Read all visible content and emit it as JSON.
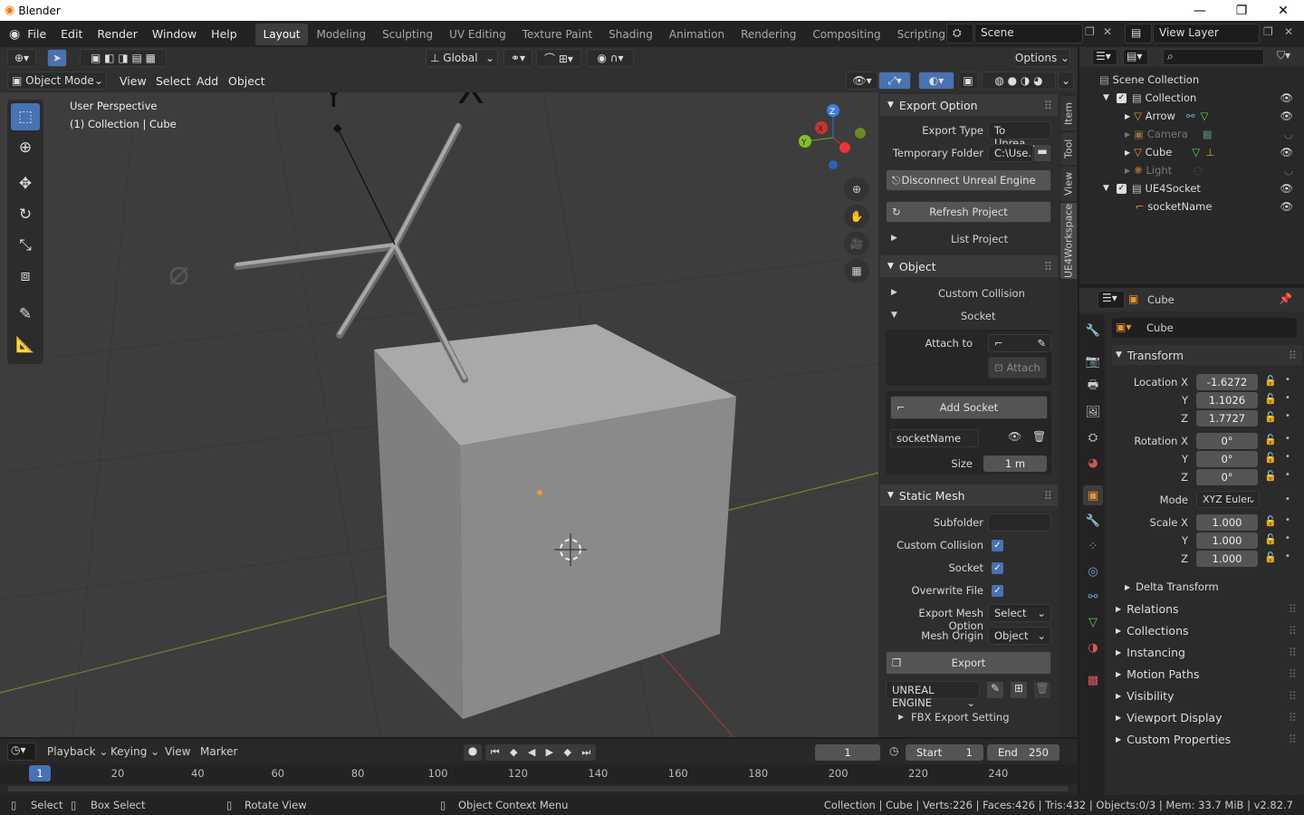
{
  "app": {
    "title": "Blender",
    "logo": "blender-logo-icon"
  },
  "menu": [
    "File",
    "Edit",
    "Render",
    "Window",
    "Help"
  ],
  "workspaces": [
    "Layout",
    "Modeling",
    "Sculpting",
    "UV Editing",
    "Texture Paint",
    "Shading",
    "Animation",
    "Rendering",
    "Compositing",
    "Scripting"
  ],
  "scene": "Scene",
  "view_layer": "View Layer",
  "viewport_header": {
    "orientation": "Global",
    "options": "Options",
    "mode": "Object Mode",
    "menus": [
      "View",
      "Select",
      "Add",
      "Object"
    ]
  },
  "viewport": {
    "perspective": "User Perspective",
    "collection": "(1) Collection | Cube",
    "axis_x": "X",
    "axis_y": "Y",
    "axis_z": "Z"
  },
  "npanel": {
    "tabs": [
      "Item",
      "Tool",
      "View",
      "UE4Workspace"
    ],
    "export_option": {
      "title": "Export Option",
      "export_type_label": "Export Type",
      "export_type": "To Unrea...",
      "temp_folder_label": "Temporary Folder",
      "temp_folder": "C:\\Use..",
      "disconnect": "Disconnect Unreal Engine",
      "refresh": "Refresh Project",
      "list": "List Project"
    },
    "object": {
      "title": "Object",
      "custom_collision": "Custom Collision",
      "socket": "Socket",
      "attach_to": "Attach to",
      "attach": "Attach",
      "add_socket": "Add Socket",
      "socket_name": "socketName",
      "size_label": "Size",
      "size": "1 m"
    },
    "static_mesh": {
      "title": "Static Mesh",
      "subfolder": "Subfolder",
      "custom_collision": "Custom Collision",
      "socket": "Socket",
      "overwrite": "Overwrite File",
      "export_mesh_option_label": "Export Mesh Option",
      "export_mesh_option": "Select",
      "mesh_origin_label": "Mesh Origin",
      "mesh_origin": "Object",
      "export": "Export",
      "engine": "UNREAL ENGINE",
      "fbx": "FBX Export Setting"
    }
  },
  "outliner": {
    "root": "Scene Collection",
    "items": [
      "Collection",
      "Arrow",
      "Camera",
      "Cube",
      "Light",
      "UE4Socket",
      "socketName"
    ]
  },
  "properties": {
    "object_name": "Cube",
    "data_name": "Cube",
    "transform": "Transform",
    "location_label": "Location X",
    "loc": [
      "-1.6272",
      "1.1026",
      "1.7727"
    ],
    "rotation_label": "Rotation X",
    "rot": [
      "0°",
      "0°",
      "0°"
    ],
    "mode_label": "Mode",
    "mode": "XYZ Euler",
    "scale_label": "Scale X",
    "scale": [
      "1.000",
      "1.000",
      "1.000"
    ],
    "y": "Y",
    "z": "Z",
    "sections": [
      "Delta Transform",
      "Relations",
      "Collections",
      "Instancing",
      "Motion Paths",
      "Visibility",
      "Viewport Display",
      "Custom Properties"
    ]
  },
  "timeline": {
    "menus": [
      "Playback",
      "Keying",
      "View",
      "Marker"
    ],
    "frame": "1",
    "start_label": "Start",
    "start": "1",
    "end_label": "End",
    "end": "250",
    "ticks": [
      "1",
      "20",
      "40",
      "60",
      "80",
      "100",
      "120",
      "140",
      "160",
      "180",
      "200",
      "220",
      "240"
    ]
  },
  "status": {
    "select": "Select",
    "box_select": "Box Select",
    "rotate": "Rotate View",
    "context": "Object Context Menu",
    "info": "Collection | Cube | Verts:226 | Faces:426 | Tris:432 | Objects:0/3 | Mem: 33.7 MiB | v2.82.7"
  },
  "colors": {
    "accent": "#4772b3",
    "grid_x": "#9b3a3a",
    "grid_y": "#6b8c2a"
  }
}
